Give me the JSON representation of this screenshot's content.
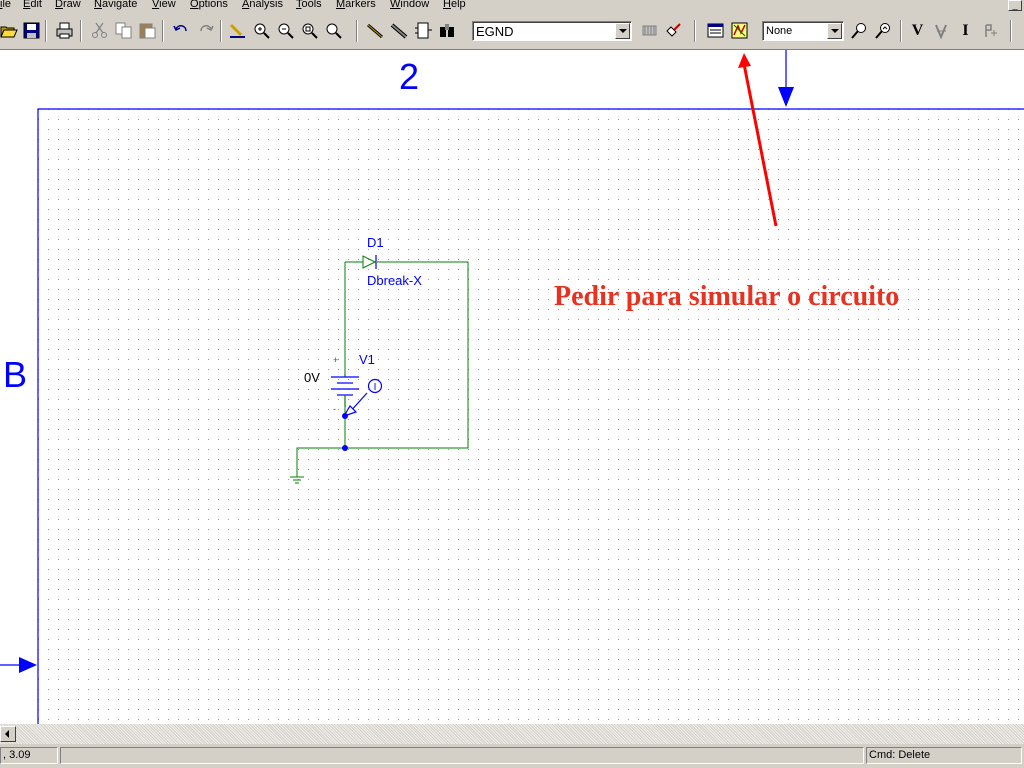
{
  "menu": {
    "items": [
      "ile",
      "Edit",
      "Draw",
      "Navigate",
      "View",
      "Options",
      "Analysis",
      "Tools",
      "Markers",
      "Window",
      "Help"
    ]
  },
  "toolbar": {
    "part_combo_value": "EGND",
    "scope_combo_value": "None",
    "letter_v": "V",
    "letter_i": "I"
  },
  "schematic": {
    "border_column_label": "2",
    "border_row_label": "B",
    "diode_ref": "D1",
    "diode_model": "Dbreak-X",
    "source_ref": "V1",
    "source_value": "0V",
    "source_plus": "+",
    "source_minus": "-",
    "current_marker_glyph": "I"
  },
  "annotation": {
    "text": "Pedir para simular o circuito",
    "color": "#e8311f"
  },
  "status": {
    "coords": ", 3.09",
    "command": "Cmd: Delete"
  },
  "colors": {
    "wire": "#008000",
    "component": "#0000ff",
    "border": "#0000ff",
    "accent_red": "#ff0000"
  }
}
